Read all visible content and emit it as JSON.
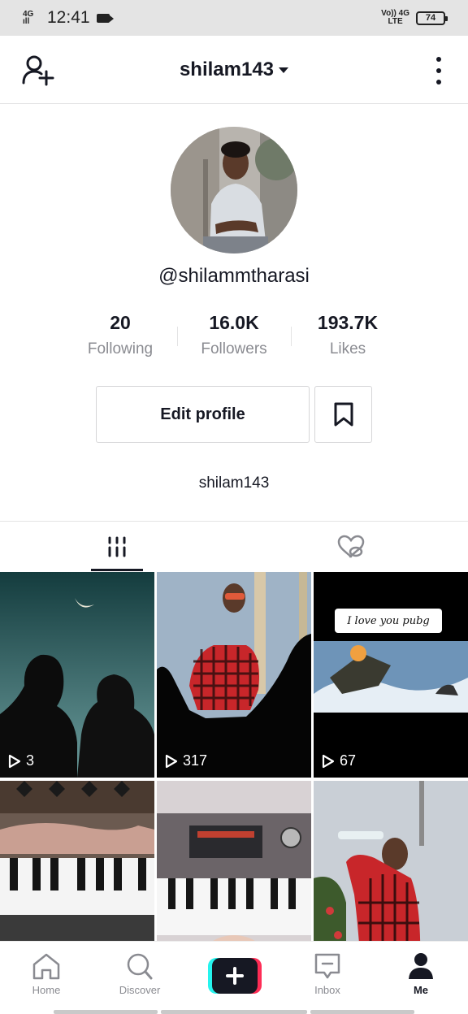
{
  "status_bar": {
    "network_top": "4G",
    "time": "12:41",
    "volte": "Vo)) 4G",
    "volte_sub": "LTE",
    "battery": "74"
  },
  "header": {
    "title": "shilam143"
  },
  "profile": {
    "username": "@shilammtharasi",
    "bio": "shilam143"
  },
  "stats": [
    {
      "value": "20",
      "label": "Following"
    },
    {
      "value": "16.0K",
      "label": "Followers"
    },
    {
      "value": "193.7K",
      "label": "Likes"
    }
  ],
  "buttons": {
    "edit_profile": "Edit profile"
  },
  "videos": [
    {
      "views": "3"
    },
    {
      "views": "317"
    },
    {
      "views": "67",
      "caption": "I love you pubg"
    },
    {
      "views": ""
    },
    {
      "views": ""
    },
    {
      "views": ""
    }
  ],
  "bottom_nav": [
    {
      "label": "Home",
      "icon": "home-icon"
    },
    {
      "label": "Discover",
      "icon": "search-icon"
    },
    {
      "label": "",
      "icon": "plus-icon"
    },
    {
      "label": "Inbox",
      "icon": "inbox-icon"
    },
    {
      "label": "Me",
      "icon": "person-icon"
    }
  ],
  "colors": {
    "text": "#161823",
    "muted": "#8a8b91",
    "border": "#e3e3e4",
    "create_cyan": "#25f4ee",
    "create_red": "#fe2c55"
  }
}
